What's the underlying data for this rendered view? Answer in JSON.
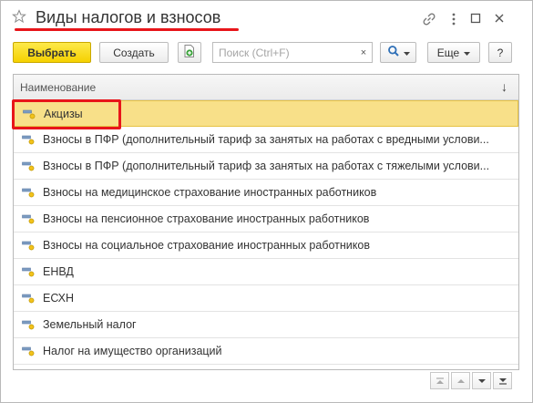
{
  "window": {
    "title": "Виды налогов и взносов"
  },
  "toolbar": {
    "select_label": "Выбрать",
    "create_label": "Создать",
    "search_placeholder": "Поиск (Ctrl+F)",
    "clear_label": "×",
    "more_label": "Еще",
    "help_label": "?"
  },
  "table": {
    "column_header": "Наименование",
    "sort_indicator": "↓",
    "rows": [
      {
        "label": "Акцизы",
        "selected": true
      },
      {
        "label": "Взносы в ПФР (дополнительный тариф за занятых на работах с вредными услови..."
      },
      {
        "label": "Взносы в ПФР (дополнительный тариф за занятых на работах с тяжелыми услови..."
      },
      {
        "label": "Взносы на медицинское страхование иностранных работников"
      },
      {
        "label": "Взносы на пенсионное страхование иностранных работников"
      },
      {
        "label": "Взносы на социальное страхование иностранных работников"
      },
      {
        "label": "ЕНВД"
      },
      {
        "label": "ЕСХН"
      },
      {
        "label": "Земельный налог"
      },
      {
        "label": "Налог на имущество организаций"
      }
    ]
  },
  "icons": {
    "favorite": "star-icon",
    "link": "link-icon",
    "more": "more-vertical-icon",
    "maximize": "maximize-icon",
    "close": "close-icon",
    "copy_list": "add-document-icon",
    "search": "search-icon",
    "row": "catalog-item-icon",
    "nav": [
      "first-page-icon",
      "previous-page-icon",
      "next-page-icon",
      "last-page-icon"
    ]
  },
  "colors": {
    "accent_underline": "#e8151a",
    "primary_button": "#f5d100",
    "selected_row": "#f8e089"
  }
}
